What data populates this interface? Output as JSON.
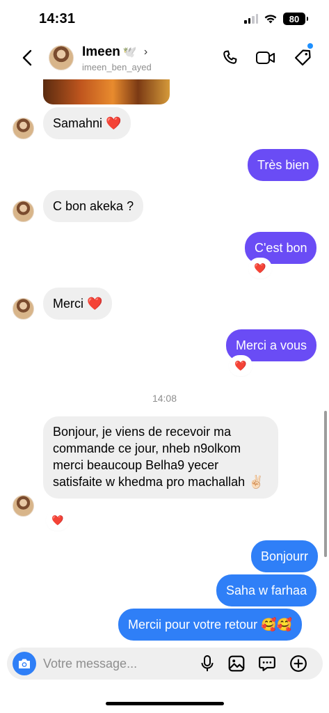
{
  "status_bar": {
    "time": "14:31",
    "battery": "80"
  },
  "header": {
    "name": "Imeen",
    "name_emoji": "🕊️",
    "username": "imeen_ben_ayed",
    "icons": [
      "back-icon",
      "phone-icon",
      "video-icon",
      "tag-icon"
    ]
  },
  "messages": {
    "m1": "Samahni ❤️",
    "m2": "Très bien",
    "m3": "C bon akeka ?",
    "m4": "C'est bon",
    "m5": "Merci ❤️",
    "m6": "Merci a vous",
    "timestamp": "14:08",
    "m7": "Bonjour, je viens de recevoir ma commande ce jour, nheb n9olkom merci beaucoup Belha9 yecer satisfaite w khedma pro machallah ✌🏻",
    "m8": "Bonjourr",
    "m9": "Saha w farhaa",
    "m10": "Mercii pour votre retour 🥰🥰"
  },
  "reactions": {
    "heart": "❤️"
  },
  "composer": {
    "placeholder": "Votre message..."
  },
  "colors": {
    "outgoing_purple": "#6a4cf5",
    "outgoing_blue": "#2f7ff7",
    "incoming": "#efefef"
  }
}
